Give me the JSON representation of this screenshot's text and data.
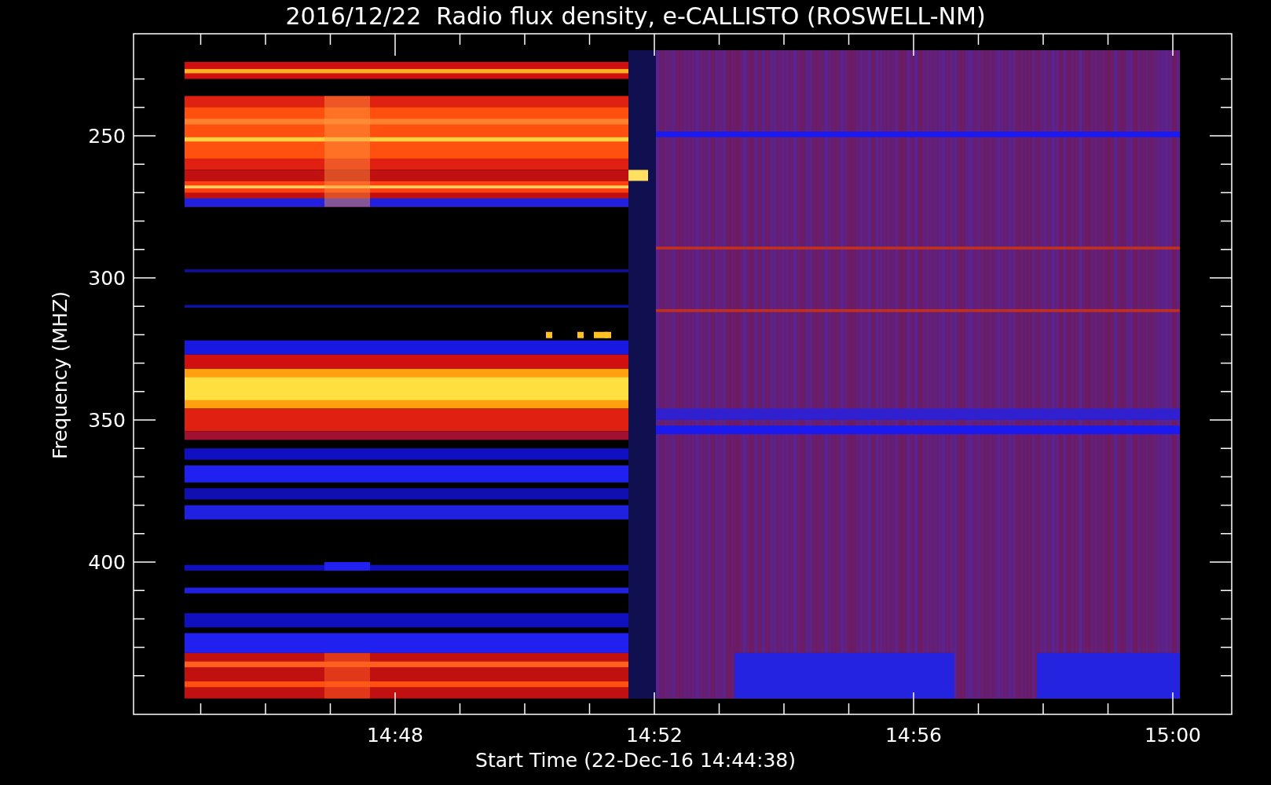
{
  "title": "2016/12/22  Radio flux density, e-CALLISTO (ROSWELL-NM)",
  "plot": {
    "ylabel": "Frequency (MHZ)",
    "xlabel": "Start Time (22-Dec-16 14:44:38)",
    "yticks": [
      "250",
      "300",
      "350",
      "400"
    ],
    "xticks": [
      "14:48",
      "14:52",
      "14:56",
      "15:00"
    ]
  }
}
